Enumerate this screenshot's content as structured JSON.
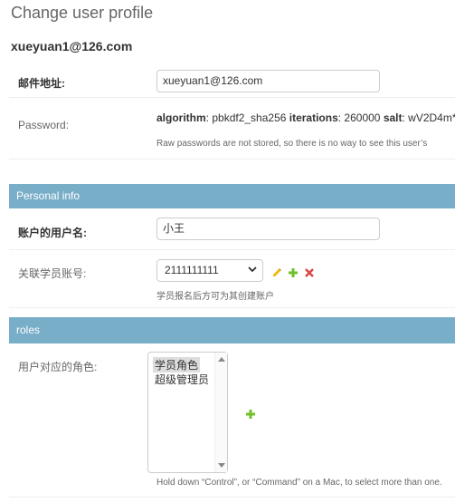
{
  "header": {
    "title": "Change user profile",
    "object": "xueyuan1@126.com"
  },
  "fields": {
    "email": {
      "label": "邮件地址:",
      "value": "xueyuan1@126.com"
    },
    "password": {
      "label": "Password:",
      "hash_algorithm_key": "algorithm",
      "hash_algorithm_val": ": pbkdf2_sha256 ",
      "hash_iterations_key": "iterations",
      "hash_iterations_val": ": 260000 ",
      "hash_salt_key": "salt",
      "hash_salt_val": ": wV2D4m*",
      "help": "Raw passwords are not stored, so there is no way to see this user’s"
    }
  },
  "personal": {
    "header": "Personal info",
    "username": {
      "label": "账户的用户名:",
      "value": "小王"
    },
    "student": {
      "label": "关联学员账号:",
      "selected": "2111111111",
      "help": "学员报名后方可为其创建账户"
    }
  },
  "roles": {
    "header": "roles",
    "label": "用户对应的角色:",
    "options": [
      "学员角色",
      "超级管理员"
    ],
    "selected_index": 0,
    "help": "Hold down “Control”, or “Command” on a Mac, to select more than one."
  },
  "colors": {
    "module_header": "#79aec8",
    "add_icon": "#70bf2b",
    "change_icon": "#efb80b",
    "delete_icon": "#dd4646"
  }
}
